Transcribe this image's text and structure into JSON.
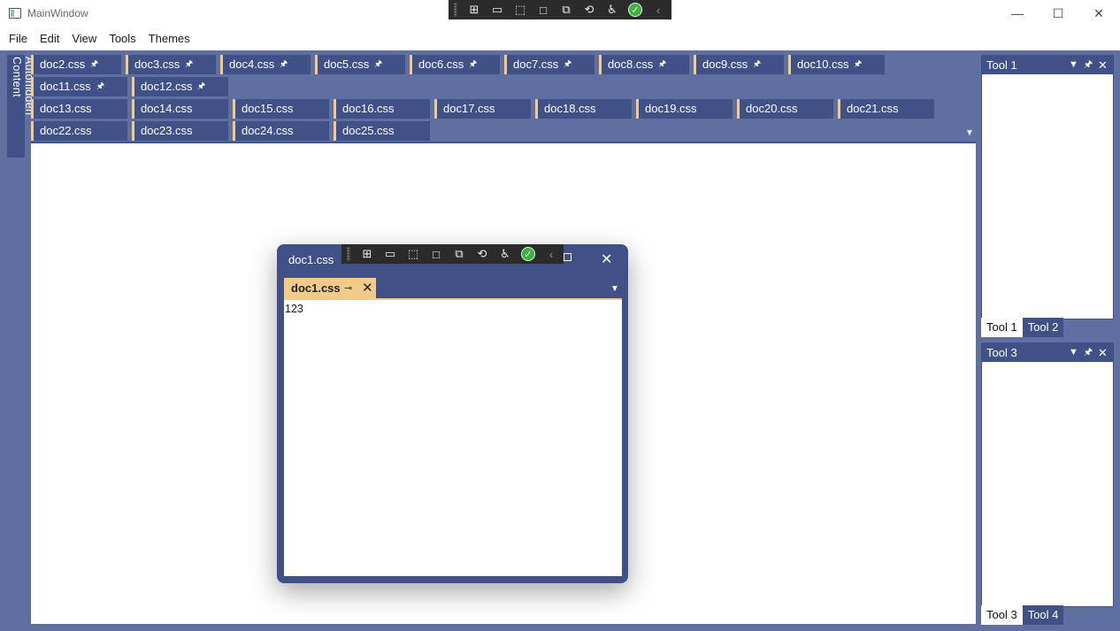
{
  "window": {
    "title": "MainWindow",
    "minimize": "—",
    "maximize": "☐",
    "close": "✕"
  },
  "menu": [
    "File",
    "Edit",
    "View",
    "Tools",
    "Themes"
  ],
  "autohidden_label": "Autohidden Content",
  "doc_tabs_row1": [
    "doc2.css",
    "doc3.css",
    "doc4.css",
    "doc5.css",
    "doc6.css",
    "doc7.css",
    "doc8.css",
    "doc9.css",
    "doc10.css"
  ],
  "doc_tabs_row2": [
    "doc11.css",
    "doc12.css"
  ],
  "doc_tabs_row3": [
    "doc13.css",
    "doc14.css",
    "doc15.css",
    "doc16.css",
    "doc17.css",
    "doc18.css",
    "doc19.css",
    "doc20.css",
    "doc21.css"
  ],
  "doc_tabs_row4": [
    "doc22.css",
    "doc23.css",
    "doc24.css",
    "doc25.css"
  ],
  "tools": {
    "top_panel": {
      "title": "Tool 1",
      "tabs": [
        "Tool 1",
        "Tool 2"
      ]
    },
    "bottom_panel": {
      "title": "Tool 3",
      "tabs": [
        "Tool 3",
        "Tool 4"
      ]
    }
  },
  "floating": {
    "title": "doc1.css",
    "tab": "doc1.css",
    "content": "123"
  },
  "colors": {
    "accent": "#405188",
    "frame": "#5e6fa0",
    "active_tab": "#f1cb87"
  }
}
